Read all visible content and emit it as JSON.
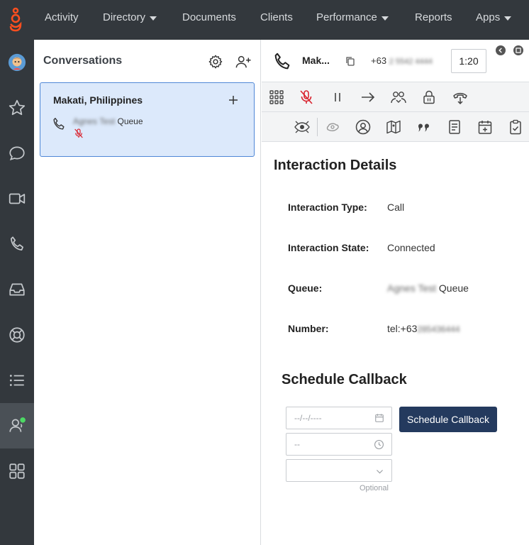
{
  "topnav": {
    "items": [
      {
        "label": "Activity"
      },
      {
        "label": "Directory"
      },
      {
        "label": "Documents"
      },
      {
        "label": "Clients"
      },
      {
        "label": "Performance"
      },
      {
        "label": "Reports"
      },
      {
        "label": "Apps"
      }
    ]
  },
  "leftnav": {
    "icons": [
      "avatar",
      "star-icon",
      "chat-bubble-icon",
      "video-icon",
      "phone-icon",
      "inbox-icon",
      "lifebuoy-icon",
      "list-icon",
      "agent-status-icon",
      "apps-grid-icon"
    ],
    "active": "agent-status-icon"
  },
  "conversations": {
    "title": "Conversations",
    "card": {
      "title": "Makati, Philippines",
      "queue_name": "Agnes Test",
      "queue_suffix": "Queue"
    }
  },
  "call": {
    "name": "Mak...",
    "number_prefix": "+63",
    "number_rest": "2 5542 4444",
    "timer": "1:20"
  },
  "details": {
    "title": "Interaction Details",
    "rows": [
      {
        "label": "Interaction Type:",
        "value": "Call"
      },
      {
        "label": "Interaction State:",
        "value": "Connected"
      },
      {
        "label": "Queue:",
        "value_blur": "Agnes Test",
        "value": "Queue"
      },
      {
        "label": "Number:",
        "value": "tel:+63",
        "value_blur": "285436444"
      }
    ]
  },
  "callback": {
    "title": "Schedule Callback",
    "date_placeholder": "--/--/----",
    "time_placeholder": "--",
    "optional_label": "Optional",
    "button_label": "Schedule Callback"
  },
  "colors": {
    "topbar": "#33383d",
    "accent": "#243a5e",
    "card_bg": "#dce9fb",
    "mute_red": "#d9232e",
    "status_green": "#4cd964",
    "logo_orange": "#ff4f1f"
  }
}
